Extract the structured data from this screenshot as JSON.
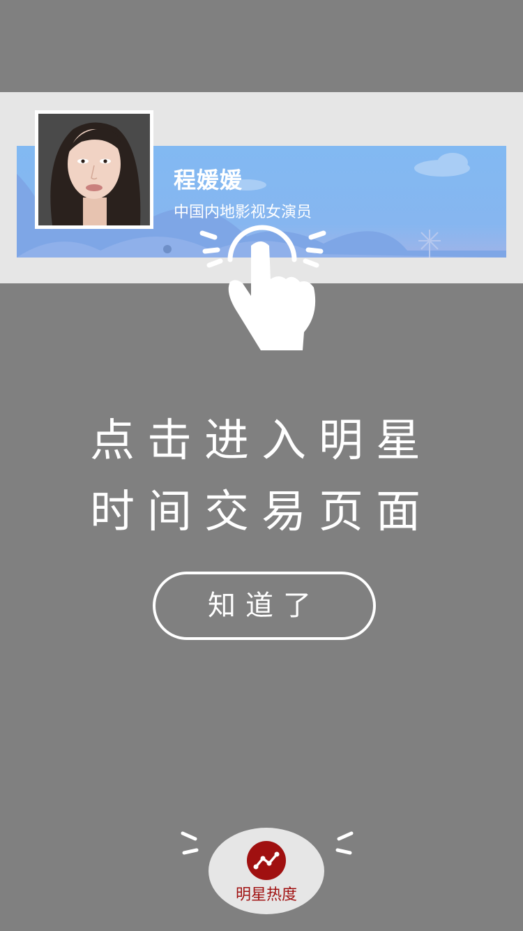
{
  "star_card": {
    "name": "程媛媛",
    "title": "中国内地影视女演员"
  },
  "guide": {
    "line1": "点击进入明星",
    "line2": "时间交易页面",
    "confirm_label": "知道了"
  },
  "bottom_tab": {
    "label": "明星热度",
    "icon": "trend-chart-icon"
  },
  "colors": {
    "overlay": "#808080",
    "card_blue": "#86b6f0",
    "accent_red": "#a01010"
  }
}
